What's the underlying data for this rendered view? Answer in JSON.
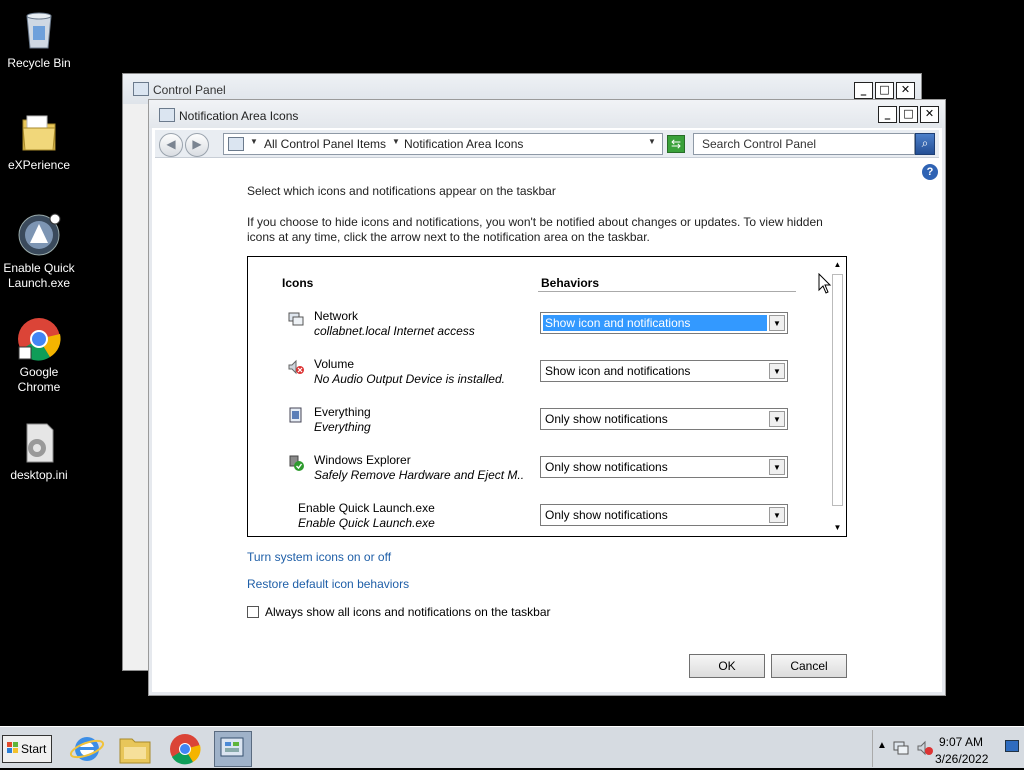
{
  "desktop": {
    "icons": [
      {
        "label": "Recycle Bin"
      },
      {
        "label": "eXPerience"
      },
      {
        "label": "Enable Quick Launch.exe"
      },
      {
        "label": "Google Chrome"
      },
      {
        "label": "desktop.ini"
      }
    ]
  },
  "back_window": {
    "title": "Control Panel"
  },
  "window": {
    "title": "Notification Area Icons",
    "address": {
      "crumb1": "All Control Panel Items",
      "crumb2": "Notification Area Icons"
    },
    "search_placeholder": "Search Control Panel",
    "heading": "Select which icons and notifications appear on the taskbar",
    "description": "If you choose to hide icons and notifications, you won't be notified about changes or updates. To view hidden icons at any time, click the arrow next to the notification area on the taskbar.",
    "columns": {
      "icons": "Icons",
      "behaviors": "Behaviors"
    },
    "rows": [
      {
        "name": "Network",
        "sub": "collabnet.local Internet access",
        "behavior": "Show icon and notifications",
        "icon": "network-icon"
      },
      {
        "name": "Volume",
        "sub": "No Audio Output Device is installed.",
        "behavior": "Show icon and notifications",
        "icon": "volume-muted-icon"
      },
      {
        "name": "Everything",
        "sub": "Everything",
        "behavior": "Only show notifications",
        "icon": "everything-icon"
      },
      {
        "name": "Windows Explorer",
        "sub": "Safely Remove Hardware and Eject M...",
        "behavior": "Only show notifications",
        "icon": "safely-remove-icon"
      },
      {
        "name": "Enable Quick Launch.exe",
        "sub": "Enable Quick Launch.exe",
        "behavior": "Only show notifications",
        "icon": ""
      }
    ],
    "links": {
      "system_icons": "Turn system icons on or off",
      "restore": "Restore default icon behaviors"
    },
    "checkbox_label": "Always show all icons and notifications on the taskbar",
    "ok": "OK",
    "cancel": "Cancel"
  },
  "taskbar": {
    "start": "Start",
    "time": "9:07 AM",
    "date": "3/26/2022"
  },
  "colors": {
    "link": "#1f5fa8",
    "selection": "#3399ff"
  }
}
